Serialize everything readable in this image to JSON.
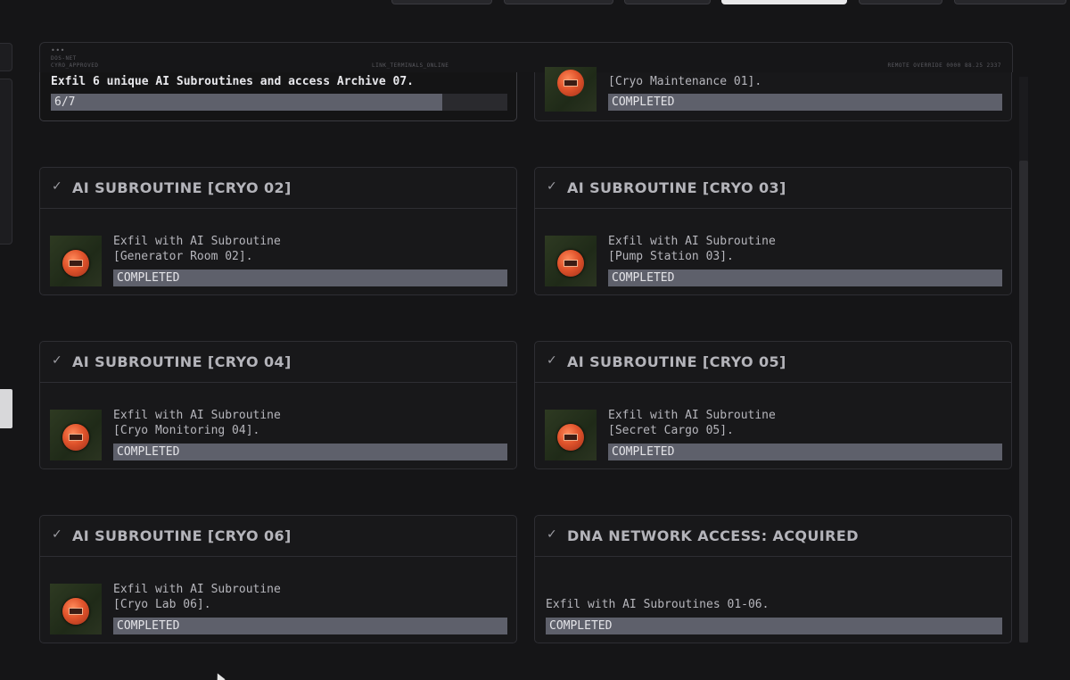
{
  "hud": {
    "dots": "•••",
    "line1": "DOS-NET",
    "line2": "CYRO_APPROVED",
    "center": "LINK_TERMINALS_ONLINE",
    "right": "REMOTE OVERRIDE 0000 88.25 2337"
  },
  "top_card": {
    "objective": "Exfil 6 unique AI Subroutines and access Archive 07.",
    "progress_text": "6/7",
    "progress_fraction": 0.857
  },
  "top_right_card": {
    "desc": "[Cryo Maintenance 01].",
    "status": "COMPLETED"
  },
  "cards": [
    {
      "title": "AI SUBROUTINE [CRYO 02]",
      "desc1": "Exfil with AI Subroutine",
      "desc2": "[Generator Room 02].",
      "status": "COMPLETED"
    },
    {
      "title": "AI SUBROUTINE [CRYO 03]",
      "desc1": "Exfil with AI Subroutine",
      "desc2": "[Pump Station 03].",
      "status": "COMPLETED"
    },
    {
      "title": "AI SUBROUTINE [CRYO 04]",
      "desc1": "Exfil with AI Subroutine",
      "desc2": "[Cryo Monitoring 04].",
      "status": "COMPLETED"
    },
    {
      "title": "AI SUBROUTINE [CRYO 05]",
      "desc1": "Exfil with AI Subroutine",
      "desc2": "[Secret Cargo 05].",
      "status": "COMPLETED"
    },
    {
      "title": "AI SUBROUTINE [CRYO 06]",
      "desc1": "Exfil with AI Subroutine",
      "desc2": "[Cryo Lab 06].",
      "status": "COMPLETED"
    },
    {
      "title": "DNA NETWORK ACCESS: ACQUIRED",
      "desc1": "Exfil with AI Subroutines 01-06.",
      "status": "COMPLETED"
    }
  ],
  "icons": {
    "check": "checkmark-icon",
    "thumb": "ai-subroutine-disc-icon"
  },
  "colors": {
    "background": "#151517",
    "status_bar": "#5e606b",
    "accent_disc": "#e0532b"
  }
}
